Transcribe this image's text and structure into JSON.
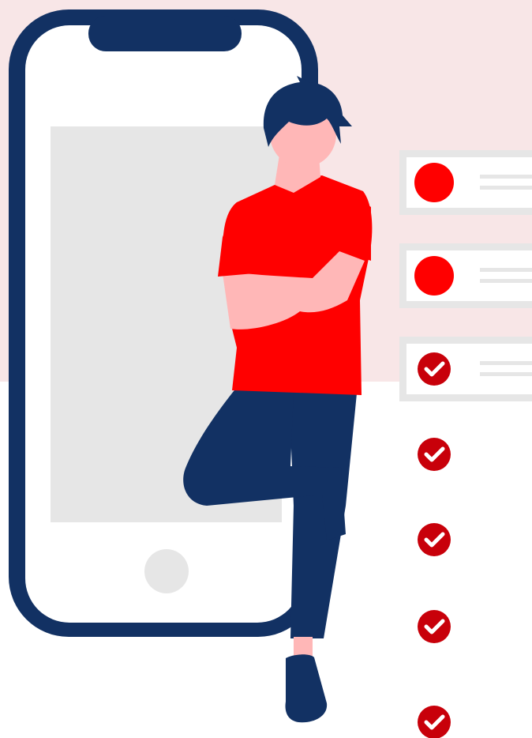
{
  "colors": {
    "band": "#f8e6e7",
    "navy": "#123163",
    "screen": "#e6e6e6",
    "accent": "#ff0000",
    "check": "#c8000a",
    "skin": "#ffb7b7",
    "card_border": "#e6e6e6",
    "line": "#e6e6e6"
  },
  "phone": {
    "notch": "phone-notch",
    "home_button": "home-button-icon"
  },
  "todo_cards": [
    {
      "status": "pending",
      "icon": "red-dot-icon"
    },
    {
      "status": "pending",
      "icon": "red-dot-icon"
    },
    {
      "status": "done",
      "icon": "check-circle-icon"
    }
  ],
  "extra_checks": [
    {
      "icon": "check-circle-icon"
    },
    {
      "icon": "check-circle-icon"
    },
    {
      "icon": "check-circle-icon"
    },
    {
      "icon": "check-circle-icon"
    }
  ],
  "person": {
    "pose": "arms-crossed-leaning",
    "shirt": "red",
    "pants": "navy"
  }
}
